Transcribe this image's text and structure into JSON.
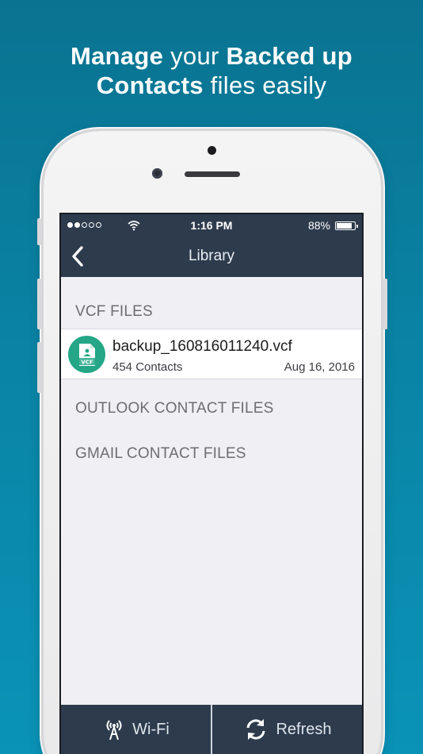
{
  "headline": {
    "line1_bold_a": "Manage",
    "line1_light": " your ",
    "line1_bold_b": "Backed up",
    "line2_bold": "Contacts",
    "line2_light": " files easily"
  },
  "status_bar": {
    "time": "1:16 PM",
    "battery": "88%"
  },
  "nav": {
    "title": "Library"
  },
  "sections": {
    "vcf": "VCF FILES",
    "outlook": "OUTLOOK CONTACT FILES",
    "gmail": "GMAIL CONTACT FILES"
  },
  "files": [
    {
      "name": "backup_160816011240.vcf",
      "contacts": "454 Contacts",
      "date": "Aug 16, 2016",
      "icon_label": "VCF"
    }
  ],
  "toolbar": {
    "wifi_label": "Wi-Fi",
    "refresh_label": "Refresh"
  },
  "colors": {
    "background": "#0a86a8",
    "navbar": "#2d3b4d",
    "file_icon": "#24a687"
  }
}
